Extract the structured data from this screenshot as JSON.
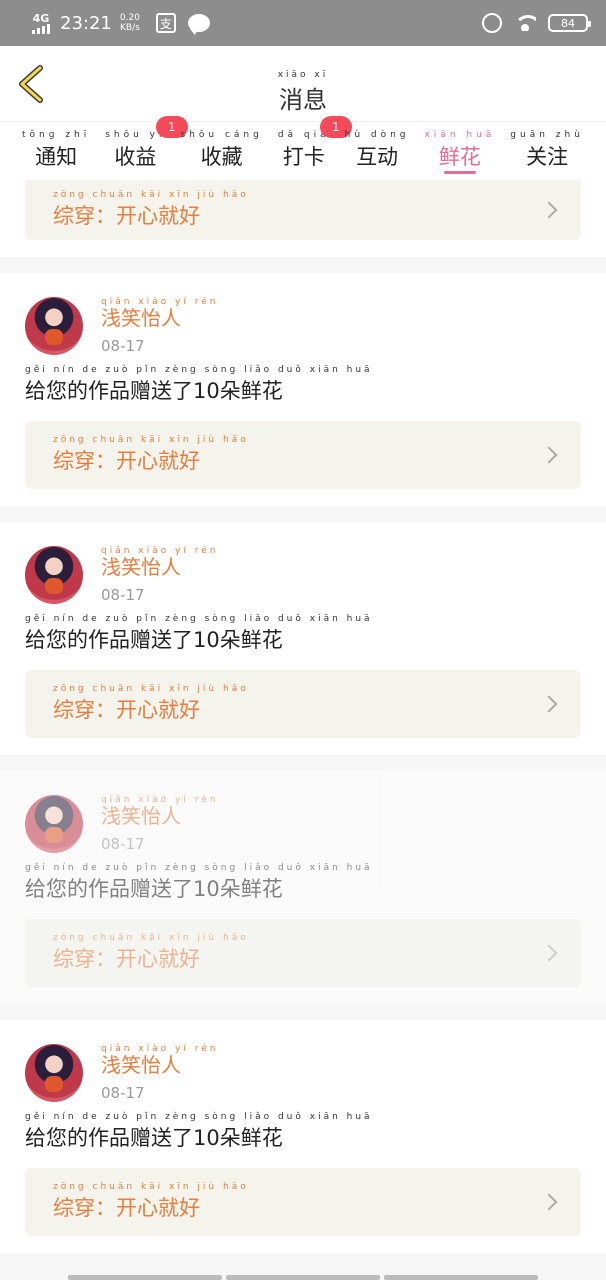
{
  "status_bar": {
    "network": "4G",
    "time": "23:21",
    "speed_value": "0.20",
    "speed_unit": "KB/s",
    "app_icon_char": "支",
    "battery": "84"
  },
  "header": {
    "title": "消息",
    "title_pinyin": "xiāo  xī"
  },
  "tabs": [
    {
      "label": "通知",
      "pinyin": "tōng zhī"
    },
    {
      "label": "收益",
      "pinyin": "shōu yì",
      "badge": "1"
    },
    {
      "label": "收藏",
      "pinyin": "shōu cáng"
    },
    {
      "label": "打卡",
      "pinyin": "dǎ  qiǎ",
      "badge": "1"
    },
    {
      "label": "互动",
      "pinyin": "hù dòng"
    },
    {
      "label": "鲜花",
      "pinyin": "xiān huā",
      "active": true
    },
    {
      "label": "关注",
      "pinyin": "guān zhù"
    }
  ],
  "messages": [
    {
      "user": "浅笑怡人",
      "user_pinyin": "qiǎn xiào yí rén",
      "date": "08-17",
      "text": "给您的作品赠送了10朵鲜花",
      "text_pinyin": "gěi nín de zuò pǐn zèng sòng liǎo  duǒ xiān huā",
      "reply": "综穿：开心就好",
      "reply_pinyin": "zōng chuān  kāi xīn jiù hǎo"
    }
  ],
  "reply_preview_top": {
    "reply": "综穿：开心就好",
    "reply_pinyin": "zōng chuān  kāi xīn jiù hǎo"
  }
}
